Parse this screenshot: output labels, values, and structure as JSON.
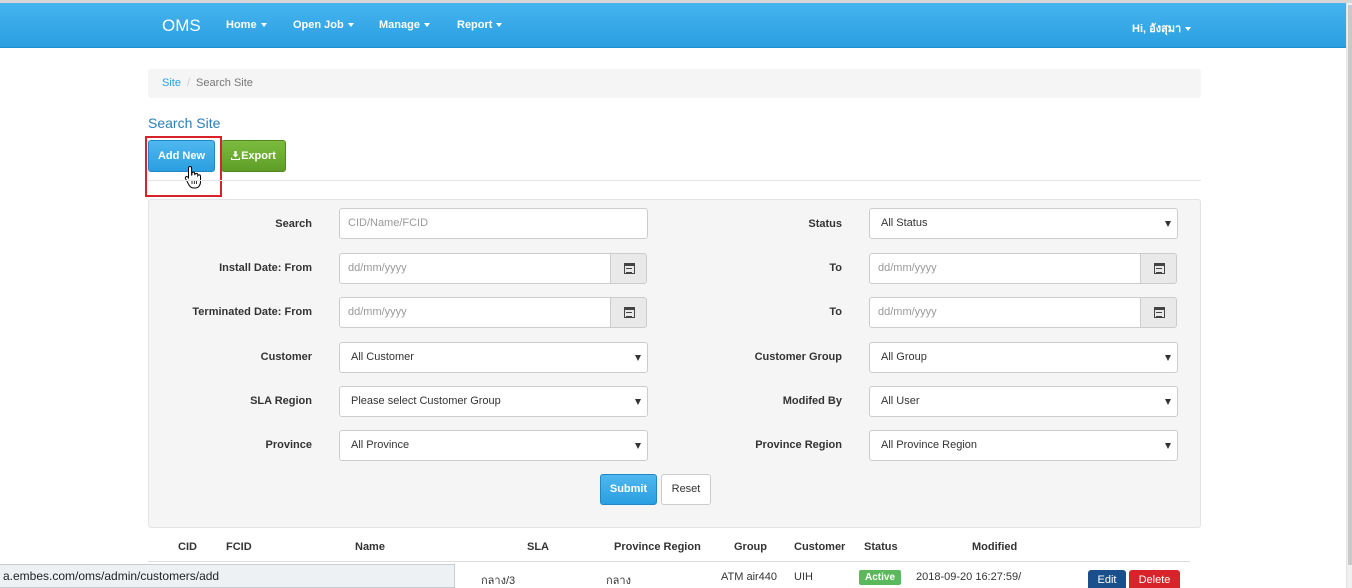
{
  "navbar": {
    "brand": "OMS",
    "items": [
      {
        "label": "Home"
      },
      {
        "label": "Open Job"
      },
      {
        "label": "Manage"
      },
      {
        "label": "Report"
      }
    ],
    "user_label": "Hi, อังสุมา"
  },
  "breadcrumb": {
    "parent": "Site",
    "separator": "/",
    "current": "Search Site"
  },
  "page_title": "Search Site",
  "actions": {
    "add_new": "Add New",
    "export": "Export"
  },
  "filters": {
    "search_label": "Search",
    "search_placeholder": "CID/Name/FCID",
    "status_label": "Status",
    "status_value": "All Status",
    "install_from_label": "Install Date: From",
    "install_from_placeholder": "dd/mm/yyyy",
    "install_to_label": "To",
    "install_to_placeholder": "dd/mm/yyyy",
    "terminated_from_label": "Terminated Date: From",
    "terminated_from_placeholder": "dd/mm/yyyy",
    "terminated_to_label": "To",
    "terminated_to_placeholder": "dd/mm/yyyy",
    "customer_label": "Customer",
    "customer_value": "All Customer",
    "customer_group_label": "Customer Group",
    "customer_group_value": "All Group",
    "sla_region_label": "SLA Region",
    "sla_region_value": "Please select Customer Group",
    "modified_by_label": "Modifed By",
    "modified_by_value": "All User",
    "province_label": "Province",
    "province_value": "All Province",
    "province_region_label": "Province Region",
    "province_region_value": "All Province Region",
    "submit": "Submit",
    "reset": "Reset"
  },
  "table": {
    "headers": [
      "CID",
      "FCID",
      "Name",
      "SLA",
      "Province Region",
      "Group",
      "Customer",
      "Status",
      "Modified"
    ],
    "rows": [
      {
        "sla": "กลาง/3",
        "province_region": "กลาง",
        "group": "ATM air440",
        "customer": "UIH",
        "status": "Active",
        "modified": "2018-09-20 16:27:59/",
        "edit": "Edit",
        "delete": "Delete"
      }
    ]
  },
  "status_bar": {
    "url": "a.embes.com/oms/admin/customers/add"
  }
}
